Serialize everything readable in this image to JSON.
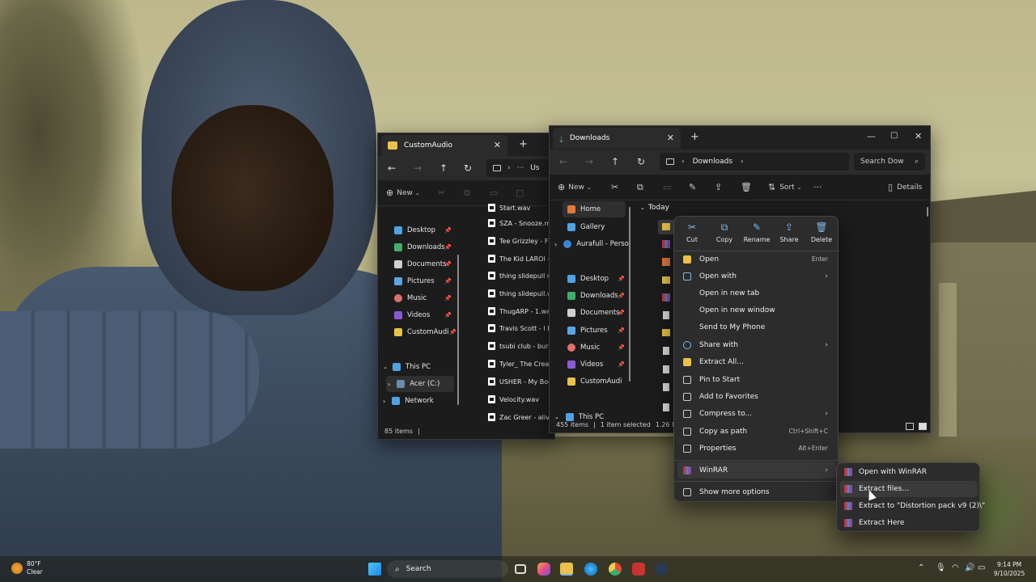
{
  "window_back": {
    "tab_title": "CustomAudio",
    "address_tail": "Us",
    "new_label": "New",
    "sidebar": [
      {
        "label": "Desktop",
        "color": "#4fa3e0"
      },
      {
        "label": "Downloads",
        "color": "#3fae6a"
      },
      {
        "label": "Documents",
        "color": "#cfcfcf"
      },
      {
        "label": "Pictures",
        "color": "#5aa7e6"
      },
      {
        "label": "Music",
        "color": "#e0706a"
      },
      {
        "label": "Videos",
        "color": "#8a5ad6"
      },
      {
        "label": "CustomAudi",
        "color": "#e8c24a"
      }
    ],
    "this_pc": "This PC",
    "drive": "Acer (C:)",
    "network": "Network",
    "files": [
      "Start.wav",
      "SZA - Snooze.mp",
      "Tee Grizzley - Flo",
      "The Kid LAROI - I",
      "thing slidepull rel",
      "thing slidepull.wa",
      "ThugARP - 1.wav",
      "Travis Scott - I KN",
      "tsubi club - burba",
      "Tyler_ The Creato",
      "USHER - My Boo.",
      "Velocity.wav",
      "Zac Greer - alive.r"
    ],
    "status": "85 items"
  },
  "window_front": {
    "tab_title": "Downloads",
    "breadcrumb": "Downloads",
    "search_placeholder": "Search Dow",
    "new_label": "New",
    "sort_label": "Sort",
    "details_label": "Details",
    "sidebar_top": [
      {
        "label": "Home",
        "color": "#e07a3a"
      },
      {
        "label": "Gallery",
        "color": "#4fa3e0"
      },
      {
        "label": "Aurafull - Person",
        "color": "#3a86d6"
      }
    ],
    "sidebar": [
      {
        "label": "Desktop",
        "color": "#4fa3e0"
      },
      {
        "label": "Downloads",
        "color": "#3fae6a"
      },
      {
        "label": "Documents",
        "color": "#cfcfcf"
      },
      {
        "label": "Pictures",
        "color": "#5aa7e6"
      },
      {
        "label": "Music",
        "color": "#e0706a"
      },
      {
        "label": "Videos",
        "color": "#8a5ad6"
      },
      {
        "label": "CustomAudi",
        "color": "#e8c24a"
      }
    ],
    "this_pc": "This PC",
    "group_header": "Today",
    "status_items": "455 items",
    "status_selected": "1 item selected",
    "status_size": "1.26 MB"
  },
  "context_menu": {
    "quick_actions": [
      {
        "label": "Cut",
        "glyph": "✂"
      },
      {
        "label": "Copy",
        "glyph": "⧉"
      },
      {
        "label": "Rename",
        "glyph": "✎"
      },
      {
        "label": "Share",
        "glyph": "⇪"
      },
      {
        "label": "Delete",
        "glyph": "🗑"
      }
    ],
    "items": [
      {
        "label": "Open",
        "shortcut": "Enter",
        "arrow": ""
      },
      {
        "label": "Open with",
        "shortcut": "",
        "arrow": "›"
      },
      {
        "label": "Open in new tab",
        "shortcut": "",
        "arrow": ""
      },
      {
        "label": "Open in new window",
        "shortcut": "",
        "arrow": ""
      },
      {
        "label": "Send to My Phone",
        "shortcut": "",
        "arrow": ""
      },
      {
        "label": "Share with",
        "shortcut": "",
        "arrow": "›"
      },
      {
        "label": "Extract All...",
        "shortcut": "",
        "arrow": ""
      },
      {
        "label": "Pin to Start",
        "shortcut": "",
        "arrow": ""
      },
      {
        "label": "Add to Favorites",
        "shortcut": "",
        "arrow": ""
      },
      {
        "label": "Compress to...",
        "shortcut": "",
        "arrow": "›"
      },
      {
        "label": "Copy as path",
        "shortcut": "Ctrl+Shift+C",
        "arrow": ""
      },
      {
        "label": "Properties",
        "shortcut": "Alt+Enter",
        "arrow": ""
      }
    ],
    "winrar": {
      "label": "WinRAR",
      "arrow": "›"
    },
    "more_options": "Show more options"
  },
  "winrar_submenu": [
    "Open with WinRAR",
    "Extract files...",
    "Extract to \"Distortion pack v9 (2)\\\"",
    "Extract Here"
  ],
  "taskbar": {
    "search_label": "Search",
    "weather_temp": "80°F",
    "weather_desc": "Clear",
    "time": "9:14 PM",
    "date": "9/10/2025"
  }
}
